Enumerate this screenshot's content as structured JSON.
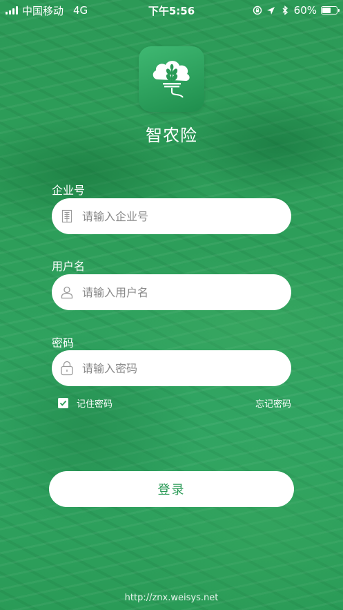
{
  "status_bar": {
    "carrier": "中国移动",
    "network": "4G",
    "time": "下午5:56",
    "battery_percent": "60%",
    "battery_level": 0.6,
    "signal_bars": 4
  },
  "app": {
    "name": "智农险",
    "logo_icon": "cloud-wheat-plug-icon"
  },
  "form": {
    "company": {
      "label": "企业号",
      "placeholder": "请输入企业号",
      "value": "",
      "icon": "building-icon"
    },
    "username": {
      "label": "用户名",
      "placeholder": "请输入用户名",
      "value": "",
      "icon": "user-icon"
    },
    "password": {
      "label": "密码",
      "placeholder": "请输入密码",
      "value": "",
      "icon": "lock-icon"
    },
    "remember_label": "记住密码",
    "remember_checked": true,
    "forgot_label": "忘记密码",
    "login_label": "登录"
  },
  "footer": {
    "url": "http://znx.weisys.net"
  },
  "colors": {
    "brand_green": "#2a9a56",
    "input_bg": "#ffffff",
    "placeholder": "#8a8a8a"
  }
}
